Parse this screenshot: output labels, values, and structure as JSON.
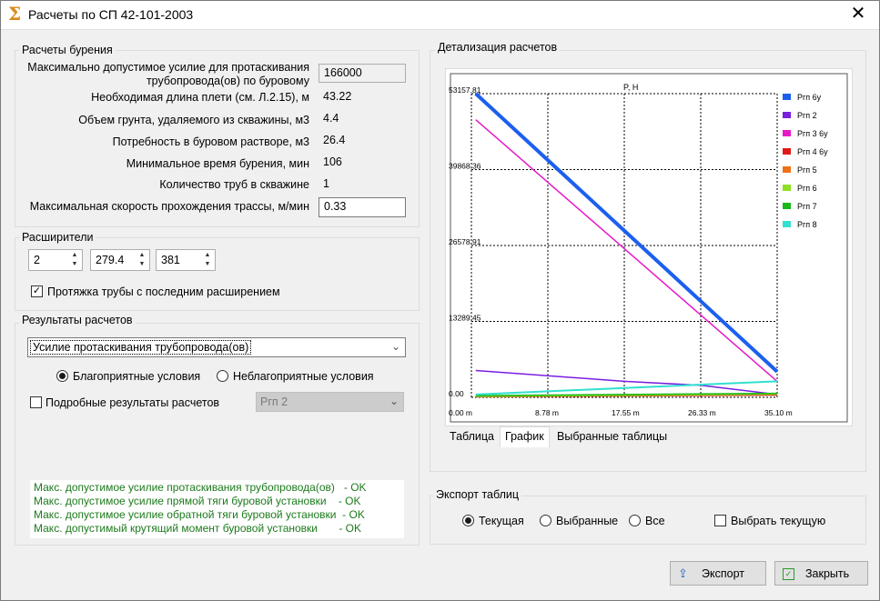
{
  "window": {
    "title": "Расчеты по СП 42-101-2003",
    "icon": "sigma-icon",
    "close_icon": "close-icon"
  },
  "drilling": {
    "title": "Расчеты бурения",
    "max_force_label": "Максимально допустимое усилие для протаскивания трубопровода(ов) по буровому",
    "max_force_value": "166000",
    "string_length_label": "Необходимая длина плети (см. Л.2.15), м",
    "string_length_value": "43.22",
    "soil_volume_label": "Объем грунта, удаляемого из скважины, м3",
    "soil_volume_value": "4.4",
    "mud_need_label": "Потребность в буровом растворе, м3",
    "mud_need_value": "26.4",
    "min_time_label": "Минимальное время бурения, мин",
    "min_time_value": "106",
    "pipes_count_label": "Количество труб в скважине",
    "pipes_count_value": "1",
    "max_speed_label": "Максимальная скорость прохождения трассы, м/мин",
    "max_speed_value": "0.33"
  },
  "reamers": {
    "title": "Расширители",
    "values": [
      "2",
      "279.4",
      "381"
    ],
    "pull_label": "Протяжка трубы с последним расширением",
    "pull_checked": true
  },
  "results": {
    "title": "Результаты расчетов",
    "combo_value": "Усилие протаскивания трубопровода(ов)",
    "favorable_label": "Благоприятные условия",
    "unfavorable_label": "Неблагоприятные условия",
    "favorable_selected": true,
    "detailed_label": "Подробные результаты расчетов",
    "detailed_checked": false,
    "pipe_combo_value": "Ргп 2",
    "checks": [
      "Макс. допустимое усилие протаскивания трубопровода(ов)   - OK",
      "Макс. допустимое усилие прямой тяги буровой установки    - OK",
      "Макс. допустимое усилие обратной тяги буровой установки  - OK",
      "Макс. допустимый крутящий момент буровой установки       - OK"
    ]
  },
  "details": {
    "title": "Детализация расчетов",
    "tabs": [
      "Таблица",
      "График",
      "Выбранные таблицы"
    ],
    "active_tab": 1
  },
  "chart_data": {
    "type": "line",
    "title": "P, H",
    "xlabel": "",
    "ylabel": "",
    "x_ticks": [
      "0.00 m",
      "8.78 m",
      "17.55 m",
      "26.33 m",
      "35.10 m"
    ],
    "y_ticks": [
      "0.00",
      "13289.45",
      "26578.91",
      "39868.36",
      "53157.81"
    ],
    "xlim": [
      0,
      35.1
    ],
    "ylim": [
      0,
      53157.81
    ],
    "grid": true,
    "legend_position": "right",
    "series": [
      {
        "name": "Ргп 6у",
        "color": "#1c5ff0",
        "width": 4,
        "points": [
          [
            0.5,
            53157.81
          ],
          [
            35.1,
            4500
          ]
        ]
      },
      {
        "name": "Ргп 2",
        "color": "#7a1ee0",
        "width": 1.5,
        "points": [
          [
            0.5,
            4700
          ],
          [
            17.55,
            2800
          ],
          [
            26.33,
            2100
          ],
          [
            35.1,
            500
          ]
        ]
      },
      {
        "name": "Ргп 3 6у",
        "color": "#e619c8",
        "width": 1.5,
        "points": [
          [
            0.5,
            48600
          ],
          [
            35.1,
            2800
          ]
        ]
      },
      {
        "name": "Ргп 4 6у",
        "color": "#e01818",
        "width": 1.5,
        "points": [
          [
            0.5,
            100
          ],
          [
            35.1,
            400
          ]
        ]
      },
      {
        "name": "Ргп 5",
        "color": "#f07018",
        "width": 1.5,
        "points": [
          [
            0.5,
            200
          ],
          [
            35.1,
            600
          ]
        ]
      },
      {
        "name": "Ргп 6",
        "color": "#8ee020",
        "width": 1.5,
        "points": [
          [
            0.5,
            150
          ],
          [
            35.1,
            550
          ]
        ]
      },
      {
        "name": "Ргп 7",
        "color": "#18b818",
        "width": 1.5,
        "points": [
          [
            0.5,
            300
          ],
          [
            35.1,
            700
          ]
        ]
      },
      {
        "name": "Ргп 8",
        "color": "#30e0d0",
        "width": 2,
        "points": [
          [
            0.5,
            500
          ],
          [
            35.1,
            2800
          ]
        ]
      }
    ]
  },
  "export": {
    "title": "Экспорт таблиц",
    "current_label": "Текущая",
    "selected_label": "Выбранные",
    "all_label": "Все",
    "current_selected": true,
    "pick_current_label": "Выбрать текущую",
    "export_button": "Экспорт",
    "export_icon": "upload-icon",
    "close_button": "Закрыть",
    "close_icon": "check-icon"
  }
}
